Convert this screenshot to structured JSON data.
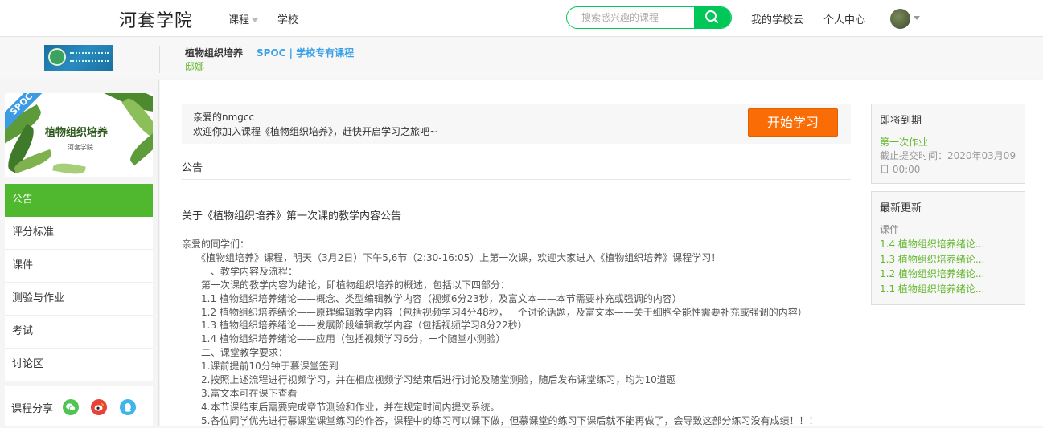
{
  "topnav": {
    "logo": "河套学院",
    "courses": "课程",
    "school": "学校",
    "search_placeholder": "搜索感兴趣的课程",
    "my_school_cloud": "我的学校云",
    "personal_center": "个人中心"
  },
  "course_header": {
    "name": "植物组织培养",
    "type": "SPOC | 学校专有课程",
    "teacher": "邸娜"
  },
  "cover": {
    "badge": "SPOC",
    "title": "植物组织培养",
    "subtitle": "河套学院"
  },
  "sidebar": {
    "items": [
      {
        "label": "公告",
        "active": true
      },
      {
        "label": "评分标准",
        "active": false
      },
      {
        "label": "课件",
        "active": false
      },
      {
        "label": "测验与作业",
        "active": false
      },
      {
        "label": "考试",
        "active": false
      },
      {
        "label": "讨论区",
        "active": false
      }
    ],
    "share_label": "课程分享",
    "share_colors": {
      "wechat": "#4cc552",
      "weibo": "#e6413a",
      "qq": "#40b5ea"
    }
  },
  "welcome": {
    "greeting": "亲爱的nmgcc",
    "message": "欢迎你加入课程《植物组织培养》，赶快开启学习之旅吧~",
    "start_button": "开始学习"
  },
  "section_title": "公告",
  "announcement": {
    "title": "关于《植物组织培养》第一次课的教学内容公告",
    "lines": [
      "亲爱的同学们：",
      "　　《植物组培养》课程，明天（3月2日）下午5,6节（2:30-16:05）上第一次课，欢迎大家进入《植物组织培养》课程学习！",
      "　　一、教学内容及流程：",
      "　　第一次课的教学内容为绪论，即植物组织培养的概述，包括以下四部分：",
      "　　1.1 植物组织培养绪论——概念、类型编辑教学内容（视频6分23秒，及富文本——本节需要补充或强调的内容）",
      "　　1.2 植物组织培养绪论——原理编辑教学内容（包括视频学习4分48秒，一个讨论话题，及富文本——关于细胞全能性需要补充或强调的内容）",
      "　　1.3 植物组织培养绪论——发展阶段编辑教学内容（包括视频学习8分22秒）",
      "　　1.4 植物组织培养绪论——应用（包括视频学习6分，一个随堂小测验）",
      "　　二、课堂教学要求：",
      "　　1.课前提前10分钟于慕课堂签到",
      "　　2.按照上述流程进行视频学习，并在相应视频学习结束后进行讨论及随堂测验，随后发布课堂练习，均为10道题",
      "　　3.富文本可在课下查看",
      "　　4.本节课结束后需要完成章节测验和作业，并在规定时间内提交系统。",
      "　　5.各位同学优先进行慕课堂课堂练习的作答，课程中的练习可以课下做，但慕课堂的练习下课后就不能再做了，会导致这部分练习没有成绩！！！"
    ]
  },
  "due_soon": {
    "title": "即将到期",
    "item": "第一次作业",
    "deadline": "截止提交时间：2020年03月09日 00:00"
  },
  "latest": {
    "title": "最新更新",
    "category": "课件",
    "items": [
      "1.4 植物组织培养绪论...",
      "1.3 植物组织培养绪论...",
      "1.2 植物组织培养绪论...",
      "1.1 植物组织培养绪论..."
    ]
  }
}
